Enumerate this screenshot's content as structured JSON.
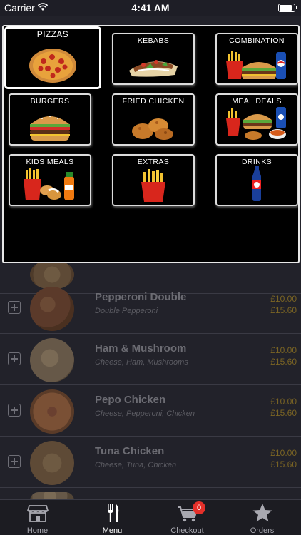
{
  "status_bar": {
    "carrier": "Carrier",
    "time": "4:41 AM",
    "battery_level": 0.9
  },
  "categories": [
    {
      "label": "PIZZAS",
      "icon": "pizza-icon",
      "selected": true
    },
    {
      "label": "KEBABS",
      "icon": "kebab-icon",
      "selected": false
    },
    {
      "label": "COMBINATION",
      "icon": "combo-meal-icon",
      "selected": false
    },
    {
      "label": "BURGERS",
      "icon": "burger-icon",
      "selected": false
    },
    {
      "label": "FRIED CHICKEN",
      "icon": "fried-chicken-icon",
      "selected": false
    },
    {
      "label": "MEAL DEALS",
      "icon": "meal-deal-icon",
      "selected": false
    },
    {
      "label": "KIDS MEALS",
      "icon": "kids-meal-icon",
      "selected": false
    },
    {
      "label": "EXTRAS",
      "icon": "fries-icon",
      "selected": false
    },
    {
      "label": "DRINKS",
      "icon": "drink-bottle-icon",
      "selected": false
    }
  ],
  "menu_items": [
    {
      "name": "Pepperoni Double",
      "description": "Double Pepperoni",
      "price_1": "£10.00",
      "price_2": "£15.60"
    },
    {
      "name": "Ham & Mushroom",
      "description": "Cheese, Ham, Mushrooms",
      "price_1": "£10.00",
      "price_2": "£15.60"
    },
    {
      "name": "Pepo Chicken",
      "description": "Cheese, Pepperoni, Chicken",
      "price_1": "£10.00",
      "price_2": "£15.60"
    },
    {
      "name": "Tuna Chicken",
      "description": "Cheese, Tuna, Chicken",
      "price_1": "£10.00",
      "price_2": "£15.60"
    }
  ],
  "tab_bar": {
    "tabs": [
      {
        "label": "Home",
        "icon": "store-icon",
        "active": false
      },
      {
        "label": "Menu",
        "icon": "fork-knife-icon",
        "active": true
      },
      {
        "label": "Checkout",
        "icon": "cart-icon",
        "active": false
      },
      {
        "label": "Orders",
        "icon": "star-icon",
        "active": false
      }
    ],
    "cart_badge": "0"
  },
  "colors": {
    "panel_bg": "#000000",
    "tile_border": "#dcdcdc",
    "price_gold": "#7a6424",
    "badge_red": "#e5302a",
    "tabbar_bg": "#1c1c22"
  }
}
